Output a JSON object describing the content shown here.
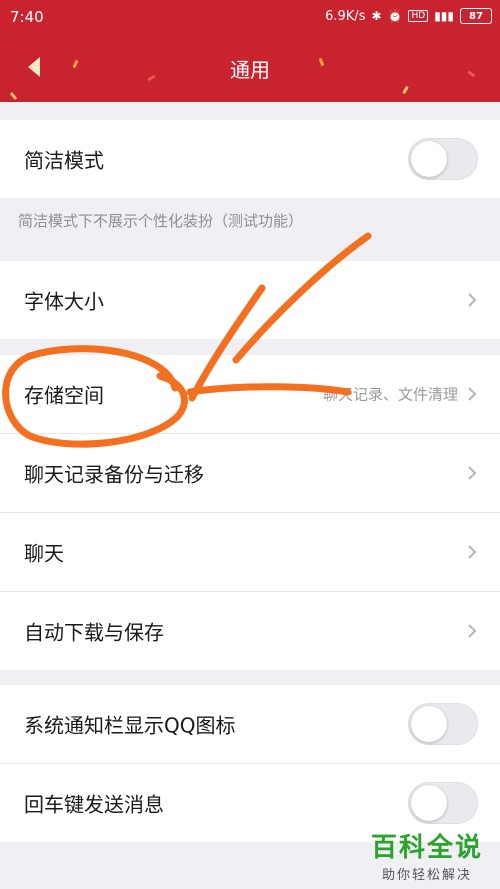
{
  "status_bar": {
    "time": "7:40",
    "network_speed": "6.9K/s",
    "icons": [
      "bluetooth-icon",
      "alarm-icon",
      "hd-icon",
      "signal-4g-icon"
    ],
    "battery": "87"
  },
  "nav": {
    "title": "通用",
    "background": "#c8232f"
  },
  "group1": {
    "simple_mode": {
      "label": "简洁模式",
      "toggle_on": false
    },
    "note": "简洁模式下不展示个性化装扮（测试功能）"
  },
  "group2": {
    "font_size": {
      "label": "字体大小"
    }
  },
  "group3": {
    "storage": {
      "label": "存储空间",
      "hint": "聊天记录、文件清理"
    },
    "backup": {
      "label": "聊天记录备份与迁移"
    },
    "chat": {
      "label": "聊天"
    },
    "auto_download": {
      "label": "自动下载与保存"
    }
  },
  "group4": {
    "notify_icon": {
      "label": "系统通知栏显示QQ图标",
      "toggle_on": false
    },
    "enter_send": {
      "label": "回车键发送消息",
      "toggle_on": false
    }
  },
  "watermark": {
    "main": "百科全说",
    "sub": "助你轻松解决",
    "color": "#2aa32a"
  },
  "annotation_color": "#f37021"
}
